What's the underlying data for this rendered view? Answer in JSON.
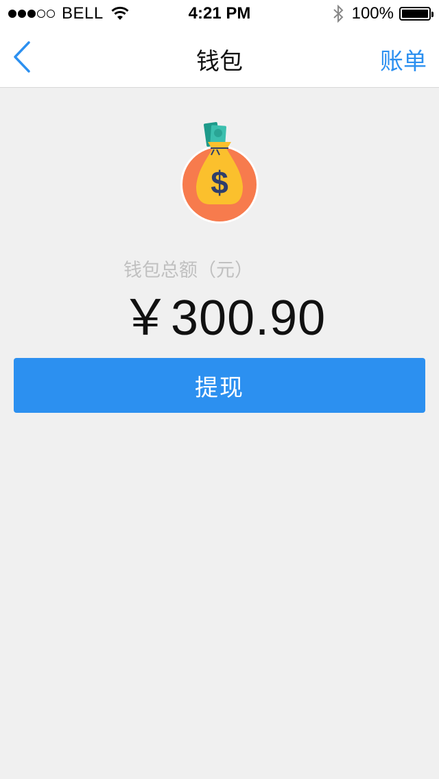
{
  "status_bar": {
    "carrier": "BELL",
    "time": "4:21 PM",
    "battery_percent": "100%",
    "signal_dots_filled": 3,
    "signal_dots_total": 5
  },
  "nav": {
    "title": "钱包",
    "right_label": "账单",
    "back_icon": "chevron-left-icon"
  },
  "wallet": {
    "icon": "money-bag-icon",
    "label": "钱包总额（元）",
    "amount": "￥300.90"
  },
  "actions": {
    "withdraw_label": "提现"
  },
  "colors": {
    "accent": "#2c90f0",
    "background": "#f0f0f0",
    "icon_circle": "#f77b4d",
    "bag": "#fbc02d",
    "dollar": "#2f3e6b"
  }
}
